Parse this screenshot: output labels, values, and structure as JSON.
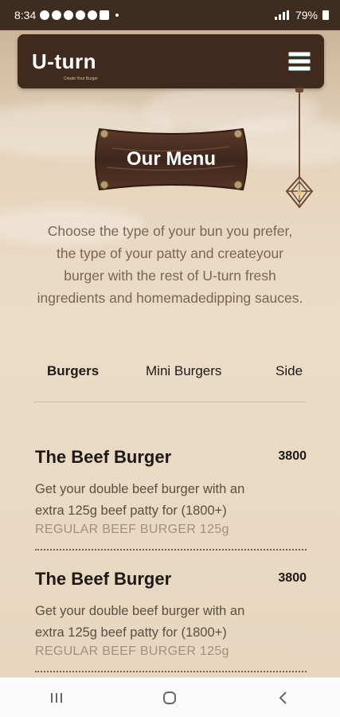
{
  "status_bar": {
    "time": "8:34",
    "battery": "79%"
  },
  "header": {
    "logo_text": "U-turn",
    "logo_tagline": "Create Your Burger",
    "menu_icon": "hamburger-icon"
  },
  "hero": {
    "title": "Our Menu",
    "intro_lines": [
      "Choose the type of your bun you prefer,",
      "the type of your patty and createyour",
      "burger with the rest of U-turn fresh",
      "ingredients and homemadedipping sauces."
    ]
  },
  "tabs": [
    {
      "label": "Burgers",
      "active": true
    },
    {
      "label": "Mini Burgers",
      "active": false
    },
    {
      "label": "Side",
      "active": false
    }
  ],
  "menu_items": [
    {
      "name": "The Beef Burger",
      "price": "3800",
      "desc_lines": [
        "Get your double beef burger with an",
        "extra 125g beef patty for (1800+)"
      ],
      "sub": "REGULAR BEEF BURGER 125g"
    },
    {
      "name": "The Beef Burger",
      "price": "3800",
      "desc_lines": [
        "Get your double beef burger with an",
        "extra 125g beef patty for (1800+)"
      ],
      "sub": "REGULAR BEEF BURGER 125g"
    }
  ],
  "nav_bar": {
    "icons": [
      "recent-apps-icon",
      "home-icon",
      "back-icon"
    ]
  },
  "colors": {
    "header_bg": "#3f2a1d",
    "status_bg": "#3e2c1f",
    "page_bg": "#e9d8c2",
    "sign_wood": "#4a2f23"
  }
}
